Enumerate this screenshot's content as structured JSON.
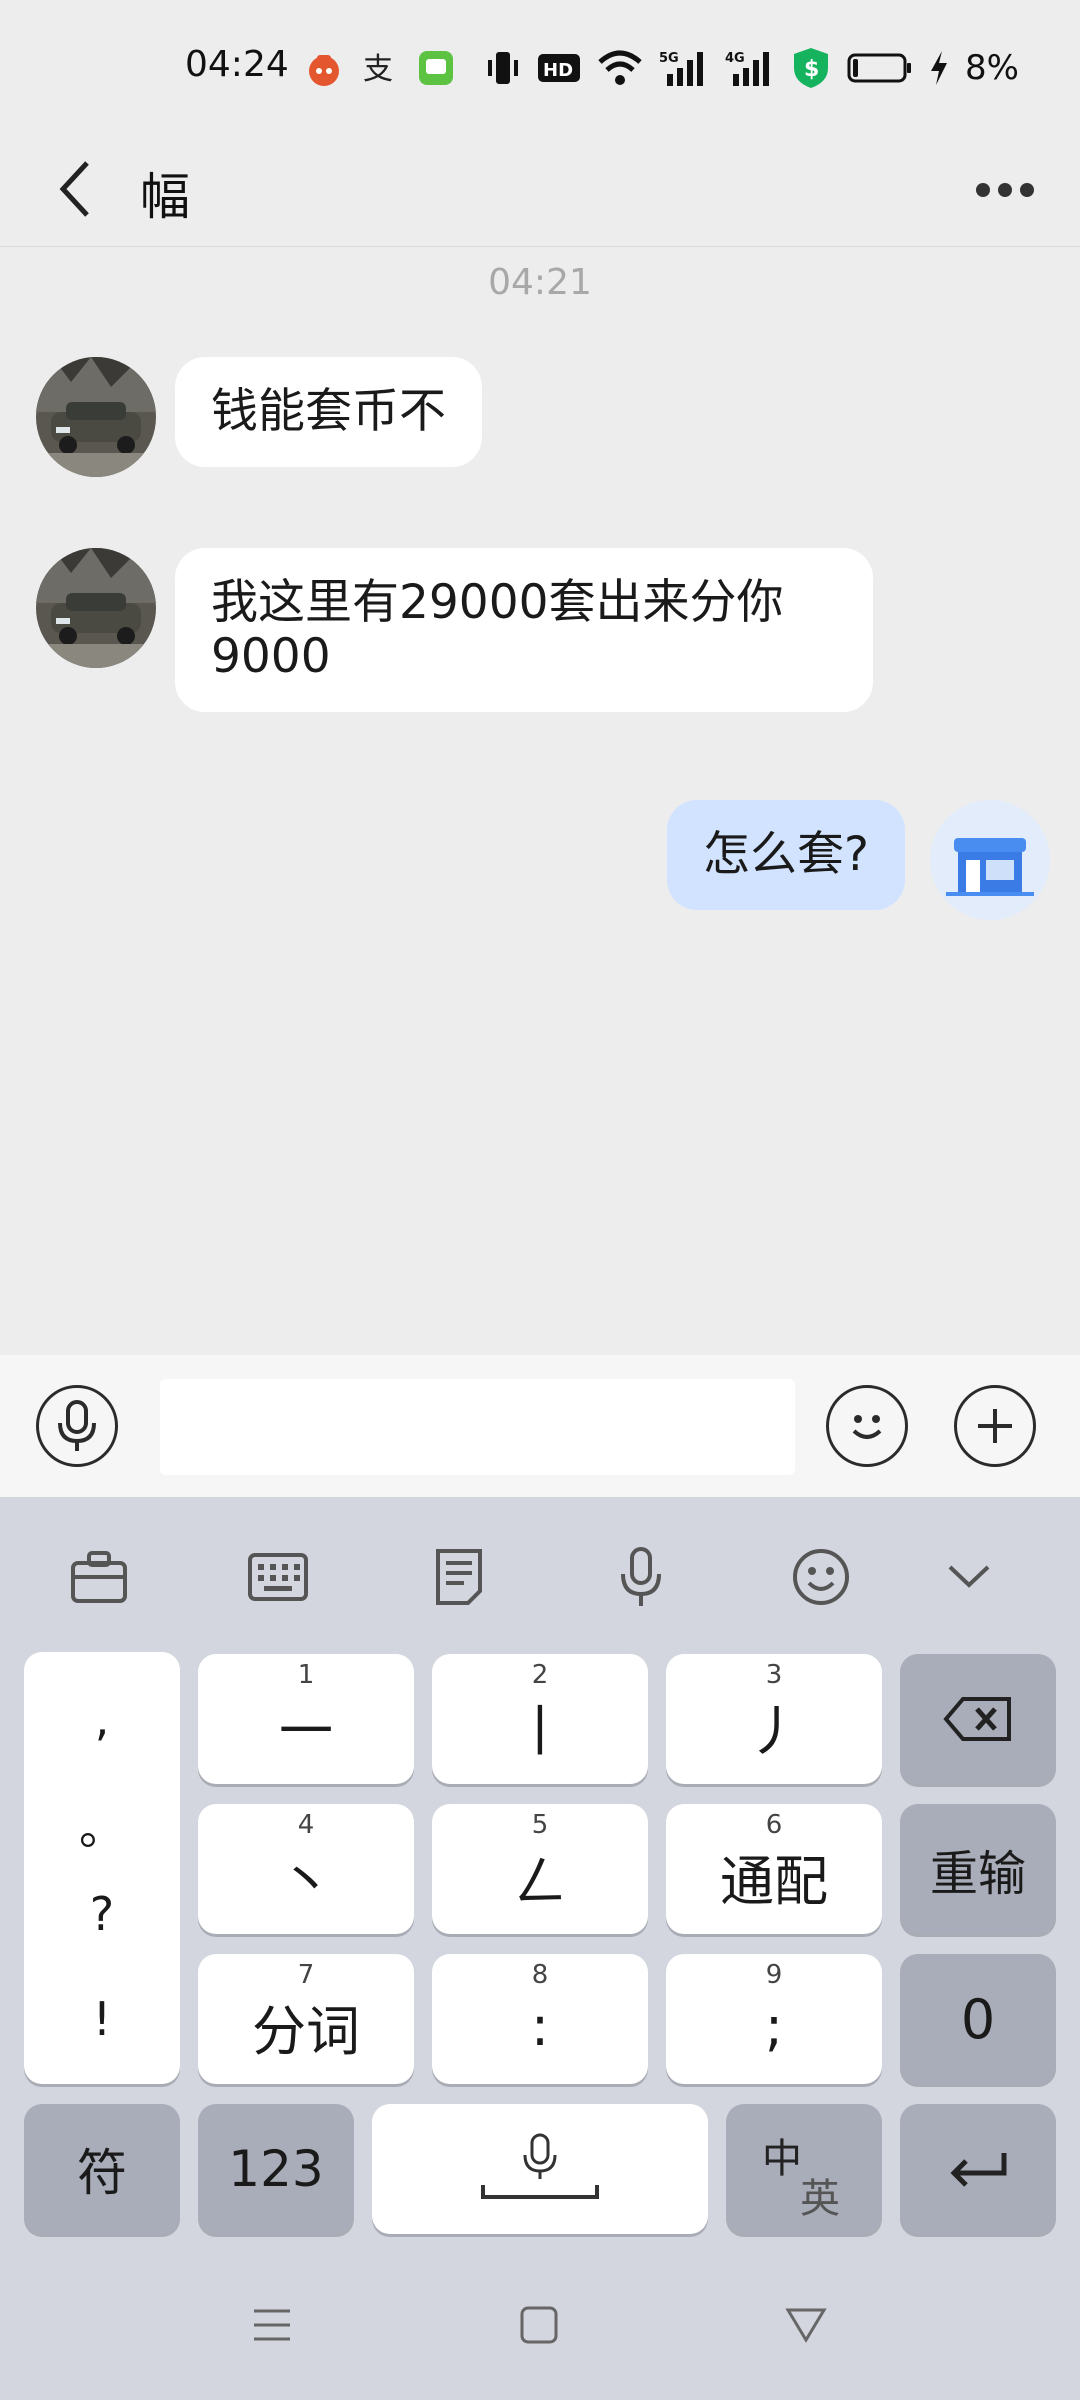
{
  "status_bar": {
    "time": "04:24",
    "battery": "8%",
    "icons": [
      "app-notification-icon",
      "alipay-icon",
      "message-app-icon",
      "vibrate-icon",
      "hd-icon",
      "wifi-icon",
      "5g-signal-icon",
      "4g-signal-icon",
      "security-shield-icon",
      "battery-icon",
      "charging-icon"
    ]
  },
  "header": {
    "title": "幅",
    "back_icon": "chevron-left-icon",
    "more_icon": "more-dots-icon"
  },
  "chat": {
    "timestamp": "04:21",
    "messages": [
      {
        "direction": "in",
        "text": "钱能套币不"
      },
      {
        "direction": "in",
        "text": "我这里有29000套出来分你9000"
      },
      {
        "direction": "out",
        "text": "怎么套?"
      }
    ]
  },
  "input_bar": {
    "voice_icon": "microphone-icon",
    "emoji_icon": "smiley-icon",
    "plus_icon": "plus-icon",
    "value": ""
  },
  "keyboard": {
    "toolbar_icons": [
      "toolbox-icon",
      "keyboard-icon",
      "clipboard-icon",
      "microphone-icon",
      "emoji-icon",
      "collapse-icon"
    ],
    "punctuation": [
      ",",
      "。",
      "?",
      "!"
    ],
    "keys": [
      {
        "num": "1",
        "label": "一"
      },
      {
        "num": "2",
        "label": "丨"
      },
      {
        "num": "3",
        "label": "丿"
      },
      {
        "num": "4",
        "label": "丶"
      },
      {
        "num": "5",
        "label": "ㄥ"
      },
      {
        "num": "6",
        "label": "通配"
      },
      {
        "num": "7",
        "label": "分词"
      },
      {
        "num": "8",
        "label": ":"
      },
      {
        "num": "9",
        "label": ";"
      }
    ],
    "reset_label": "重输",
    "zero_label": "0",
    "symbol_label": "符",
    "num_label": "123",
    "lang_label_top": "中",
    "lang_label_bottom": "英"
  },
  "nav_bar": {
    "icons": [
      "menu-icon",
      "home-icon",
      "back-triangle-icon"
    ]
  }
}
